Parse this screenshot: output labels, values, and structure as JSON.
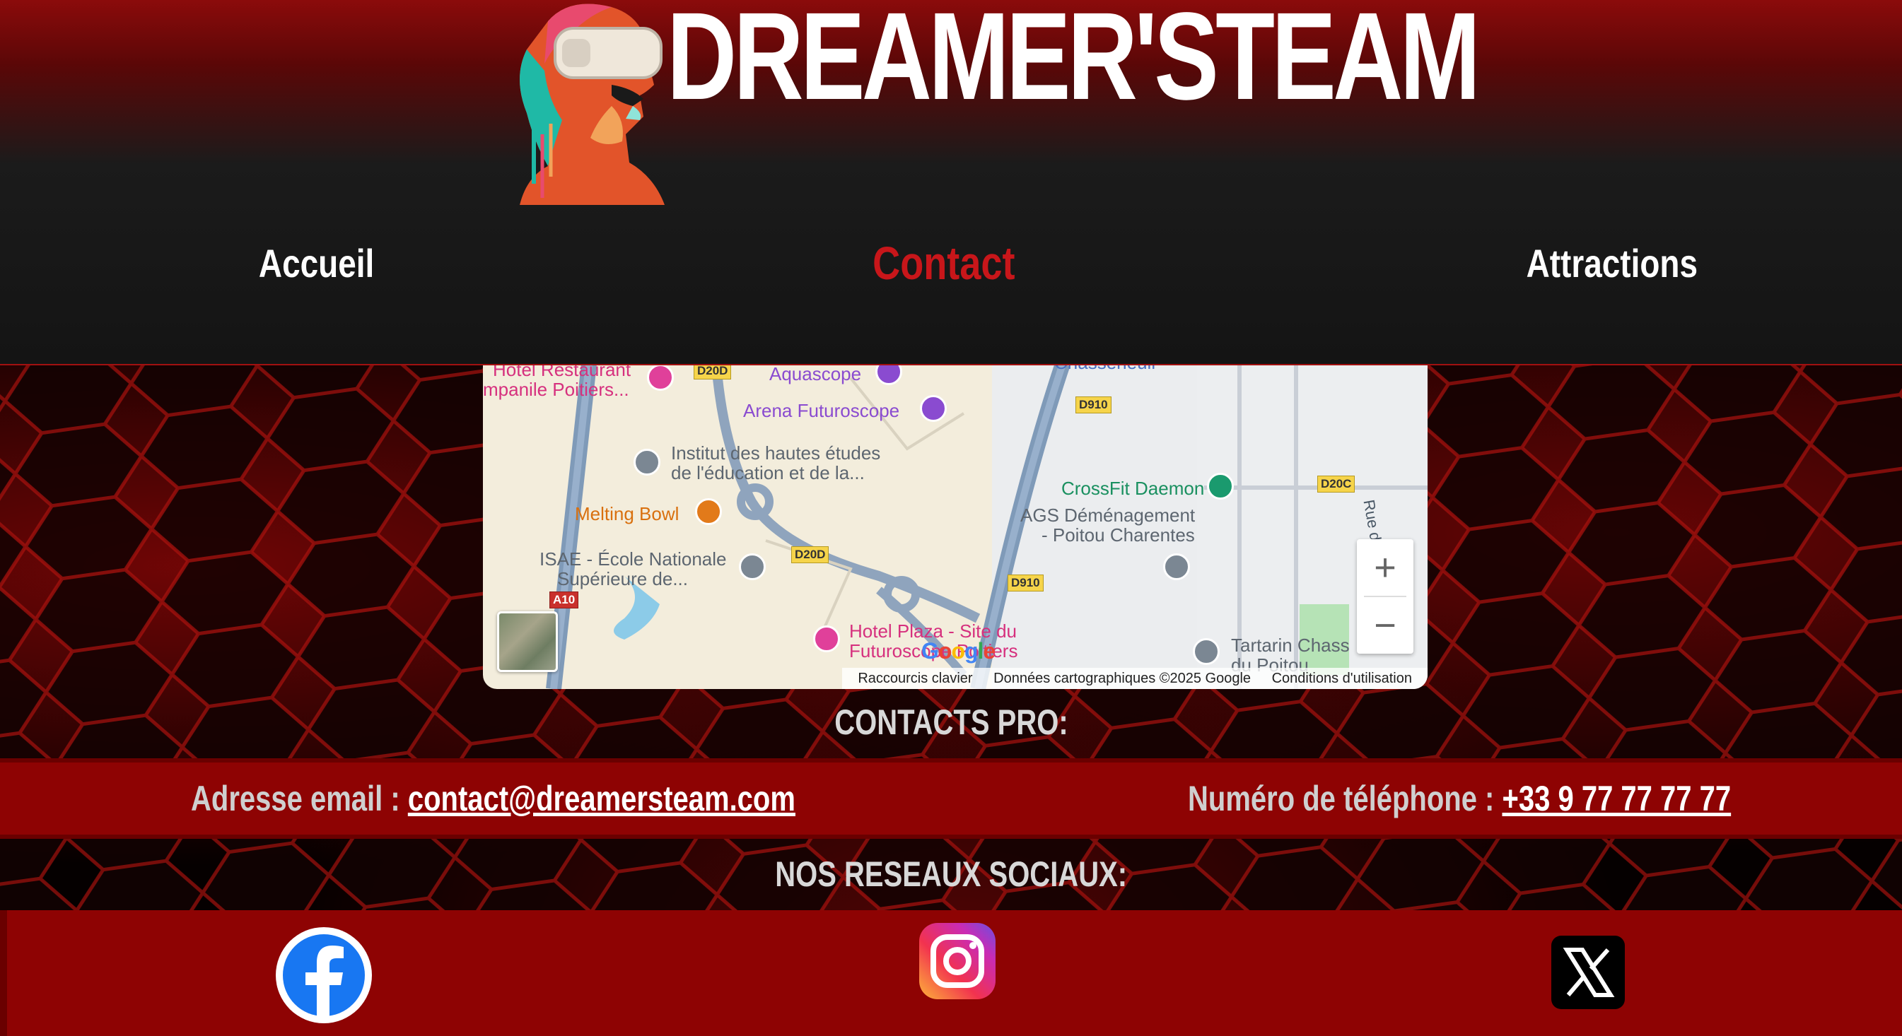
{
  "header": {
    "brand_title": "DREAMER'STEAM",
    "logo": "vr-headset-statue-logo"
  },
  "nav": {
    "items": [
      {
        "label": "Accueil",
        "active": false
      },
      {
        "label": "Contact",
        "active": true
      },
      {
        "label": "Attractions",
        "active": false
      }
    ],
    "active_color": "#c8161a"
  },
  "map": {
    "places": [
      {
        "label": "Hotel Restaurant",
        "color": "pink"
      },
      {
        "label": "mpanile Poitiers...",
        "color": "pink"
      },
      {
        "label": "Aquascope",
        "color": "purple"
      },
      {
        "label": "Chasseneuil",
        "color": "grey"
      },
      {
        "label": "Arena Futuroscope",
        "color": "purple"
      },
      {
        "label": "Institut des hautes études",
        "color": "grey"
      },
      {
        "label": "de l'éducation et de la...",
        "color": "grey"
      },
      {
        "label": "Melting Bowl",
        "color": "orange"
      },
      {
        "label": "ISAE - École Nationale",
        "color": "grey"
      },
      {
        "label": "Supérieure de...",
        "color": "grey"
      },
      {
        "label": "CrossFit Daemon",
        "color": "green"
      },
      {
        "label": "AGS Déménagement",
        "color": "grey"
      },
      {
        "label": "- Poitou Charentes",
        "color": "grey"
      },
      {
        "label": "Hotel Plaza - Site du",
        "color": "pink"
      },
      {
        "label": "Futuroscope Poitiers",
        "color": "pink"
      },
      {
        "label": "Tartarin Chass",
        "color": "grey"
      },
      {
        "label": "du Poitou",
        "color": "grey"
      },
      {
        "label": "Rue de",
        "color": "grey"
      }
    ],
    "road_shields": [
      "D20D",
      "D910",
      "D20C",
      "D20D",
      "D910",
      "A10"
    ],
    "zoom_in": "+",
    "zoom_out": "−",
    "google": "Google",
    "attribution": {
      "shortcuts": "Raccourcis clavier",
      "data": "Données cartographiques ©2025 Google",
      "terms": "Conditions d'utilisation"
    }
  },
  "contacts": {
    "title": "CONTACTS PRO:",
    "email_label": "Adresse email : ",
    "email_value": "contact@dreamersteam.com",
    "phone_label": "Numéro de téléphone : ",
    "phone_value": "+33 9 77 77 77 77"
  },
  "social": {
    "title": "NOS RESEAUX SOCIAUX:",
    "networks": [
      "facebook-icon",
      "instagram-icon",
      "x-icon"
    ]
  },
  "colors": {
    "band_red": "#8e0303",
    "header_top": "#8b0b0b"
  }
}
